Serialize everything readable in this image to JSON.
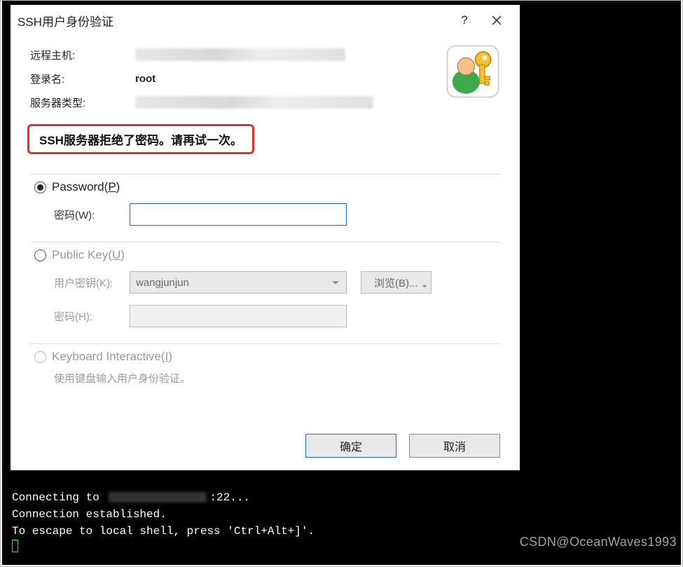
{
  "dialog": {
    "title": "SSH用户身份验证",
    "info": {
      "remote_host_label": "远程主机:",
      "login_label": "登录名:",
      "login_value": "root",
      "server_type_label": "服务器类型:"
    },
    "error_message": "SSH服务器拒绝了密码。请再试一次。",
    "password_option": {
      "label": "Password(",
      "accel": "P",
      "label_end": ")",
      "pw_label": "密码(",
      "pw_accel": "W",
      "pw_label_end": "):",
      "value": ""
    },
    "pubkey_option": {
      "label": "Public Key(",
      "accel": "U",
      "label_end": ")",
      "userkey_label": "用户密钥(",
      "userkey_accel": "K",
      "userkey_label_end": "):",
      "userkey_value": "wangjunjun",
      "browse_label": "浏览(",
      "browse_accel": "B",
      "browse_end": ")...",
      "pw_label": "密码(",
      "pw_accel": "H",
      "pw_label_end": "):"
    },
    "ki_option": {
      "label": "Keyboard Interactive(",
      "accel": "I",
      "label_end": ")",
      "desc": "使用键盘输入用户身份验证。"
    },
    "buttons": {
      "ok": "确定",
      "cancel": "取消"
    }
  },
  "terminal": {
    "line1a": "Connecting to ",
    "line1b": ":22...",
    "line2": "Connection established.",
    "line3": "To escape to local shell, press 'Ctrl+Alt+]'."
  },
  "watermark": "CSDN@OceanWaves1993"
}
